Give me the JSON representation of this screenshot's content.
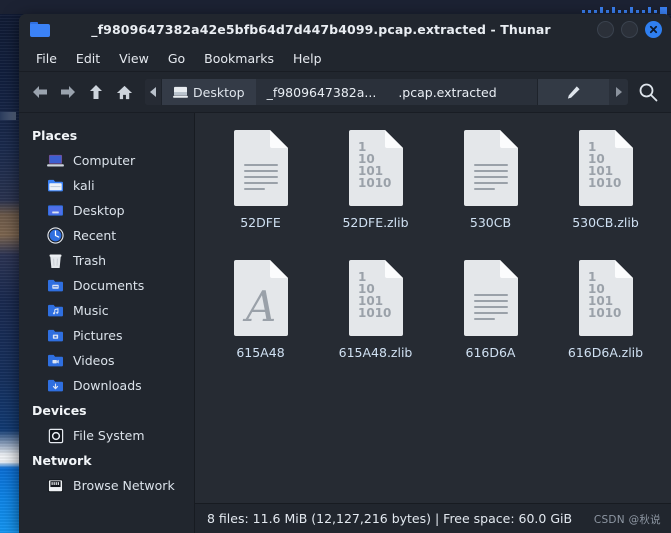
{
  "window": {
    "title": "_f9809647382a42e5bfb64d7d447b4099.pcap.extracted - Thunar",
    "folder_icon": "folder-icon",
    "controls": {
      "minimize": "minimize-button",
      "maximize": "maximize-button",
      "close": "close-button"
    },
    "close_color": "#2f7ff0"
  },
  "menubar": {
    "items": [
      {
        "label": "File"
      },
      {
        "label": "Edit"
      },
      {
        "label": "View"
      },
      {
        "label": "Go"
      },
      {
        "label": "Bookmarks"
      },
      {
        "label": "Help"
      }
    ]
  },
  "toolbar": {
    "back": "back-arrow-icon",
    "forward": "forward-arrow-icon",
    "up": "up-arrow-icon",
    "home": "home-icon",
    "search": "search-icon",
    "edit_path": "pencil-icon",
    "pathbar": {
      "scroll_left": "chevron-left-icon",
      "scroll_right": "chevron-right-icon",
      "crumbs": [
        {
          "label": "Desktop",
          "icon": "desktop-icon",
          "active": true
        },
        {
          "label": "_f9809647382a...",
          "icon": "",
          "active": false
        },
        {
          "label": ".pcap.extracted",
          "icon": "",
          "active": false
        }
      ]
    }
  },
  "sidebar": {
    "sections": [
      {
        "heading": "Places",
        "items": [
          {
            "label": "Computer",
            "icon": "computer-icon"
          },
          {
            "label": "kali",
            "icon": "home-folder-icon"
          },
          {
            "label": "Desktop",
            "icon": "desktop-folder-icon"
          },
          {
            "label": "Recent",
            "icon": "clock-icon"
          },
          {
            "label": "Trash",
            "icon": "trash-icon"
          },
          {
            "label": "Documents",
            "icon": "documents-folder-icon"
          },
          {
            "label": "Music",
            "icon": "music-folder-icon"
          },
          {
            "label": "Pictures",
            "icon": "pictures-folder-icon"
          },
          {
            "label": "Videos",
            "icon": "videos-folder-icon"
          },
          {
            "label": "Downloads",
            "icon": "downloads-folder-icon"
          }
        ]
      },
      {
        "heading": "Devices",
        "items": [
          {
            "label": "File System",
            "icon": "harddisk-icon"
          }
        ]
      },
      {
        "heading": "Network",
        "items": [
          {
            "label": "Browse Network",
            "icon": "network-icon"
          }
        ]
      }
    ]
  },
  "files": [
    {
      "name": "52DFE",
      "icon": "text-document-icon"
    },
    {
      "name": "52DFE.zlib",
      "icon": "binary-document-icon"
    },
    {
      "name": "530CB",
      "icon": "text-document-icon"
    },
    {
      "name": "530CB.zlib",
      "icon": "binary-document-icon"
    },
    {
      "name": "615A48",
      "icon": "font-document-icon"
    },
    {
      "name": "615A48.zlib",
      "icon": "binary-document-icon"
    },
    {
      "name": "616D6A",
      "icon": "text-document-icon"
    },
    {
      "name": "616D6A.zlib",
      "icon": "binary-document-icon"
    }
  ],
  "icon_glyphs": {
    "binary_lines": [
      "1",
      "10",
      "101",
      "1010"
    ],
    "font_glyph": "A"
  },
  "statusbar": {
    "text": "8 files: 11.6 MiB (12,127,216 bytes) | Free space: 60.0 GiB",
    "watermark": "CSDN @秋说"
  }
}
